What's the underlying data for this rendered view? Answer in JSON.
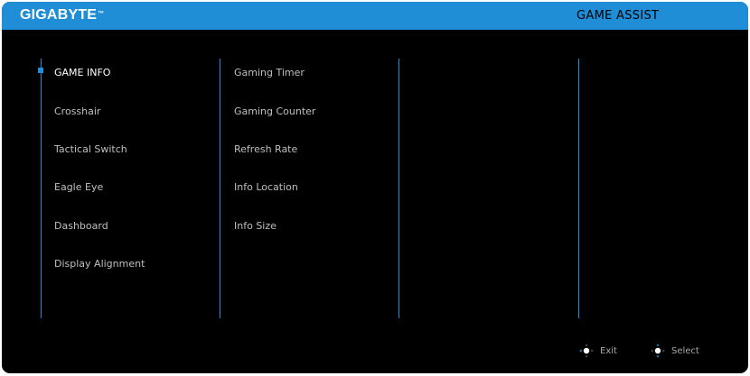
{
  "header": {
    "brand": "GIGABYTE",
    "brand_mark": "™",
    "title": "GAME ASSIST"
  },
  "menu": {
    "level1": [
      {
        "label": "GAME INFO",
        "selected": true
      },
      {
        "label": "Crosshair"
      },
      {
        "label": "Tactical Switch"
      },
      {
        "label": "Eagle Eye"
      },
      {
        "label": "Dashboard"
      },
      {
        "label": "Display Alignment"
      }
    ],
    "level2": [
      {
        "label": "Gaming Timer"
      },
      {
        "label": "Gaming Counter"
      },
      {
        "label": "Refresh Rate"
      },
      {
        "label": "Info Location"
      },
      {
        "label": "Info Size"
      }
    ]
  },
  "footer": {
    "exit": {
      "label": "Exit",
      "icon": "joystick-left-icon"
    },
    "select": {
      "label": "Select",
      "icon": "joystick-up-down-icon"
    }
  },
  "colors": {
    "accent": "#1f8ed6",
    "background": "#000000",
    "text": "#bfbfbf",
    "text_active": "#ffffff"
  }
}
